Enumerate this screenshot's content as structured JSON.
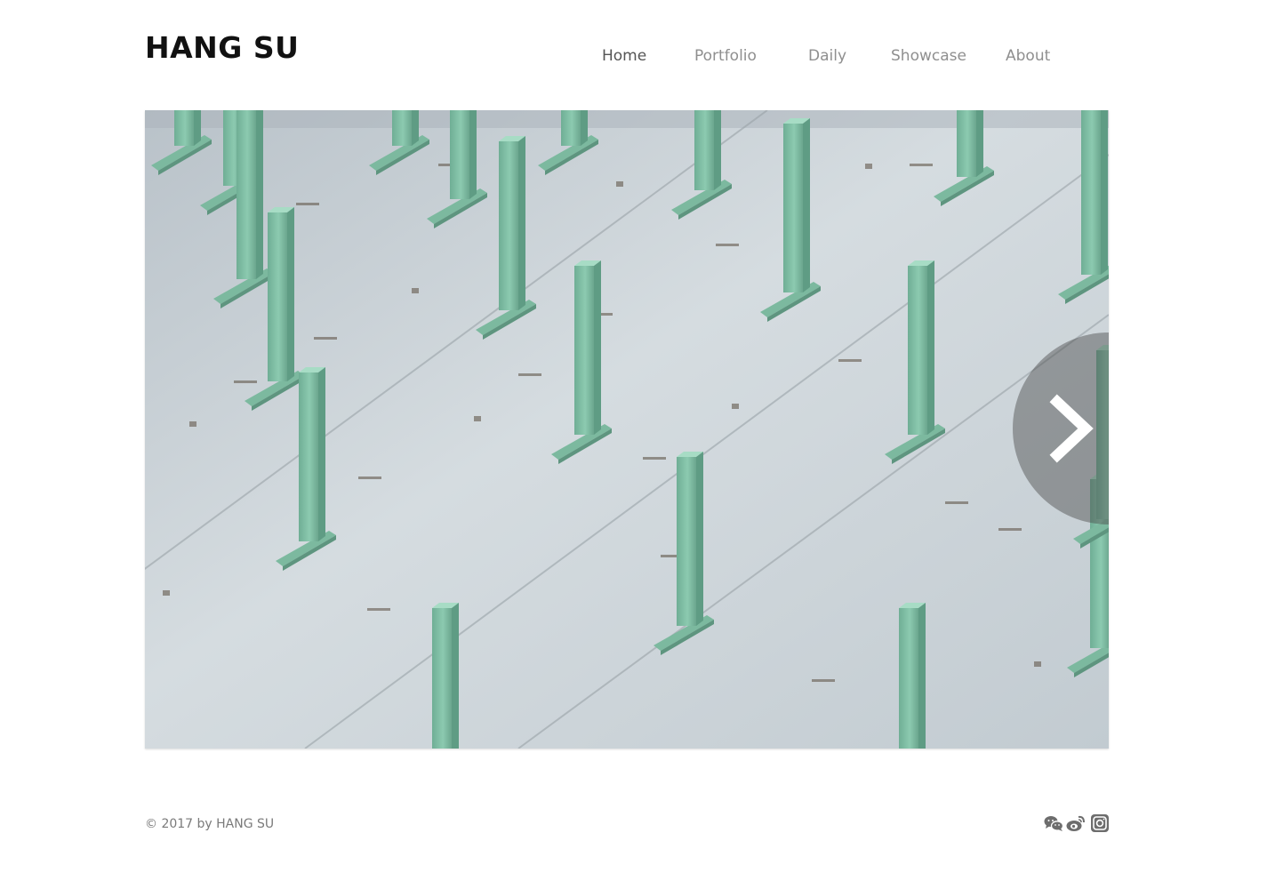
{
  "site": {
    "title": "HANG SU"
  },
  "nav": {
    "items": [
      {
        "label": "Home",
        "active": true
      },
      {
        "label": "Portfolio",
        "active": false
      },
      {
        "label": "Daily",
        "active": false
      },
      {
        "label": "Showcase",
        "active": false
      },
      {
        "label": "About",
        "active": false
      }
    ]
  },
  "slideshow": {
    "image": "photo of mint-green T-shaped posts on a concrete slab",
    "next_icon": "chevron-right-icon"
  },
  "footer": {
    "copyright": "© 2017 by HANG SU",
    "social": [
      {
        "icon": "wechat-icon"
      },
      {
        "icon": "weibo-icon"
      },
      {
        "icon": "instagram-icon"
      }
    ]
  },
  "colors": {
    "post_green": "#7fbfa5",
    "concrete": "#c9d2d8",
    "nav_active": "#555555",
    "nav_inactive": "#8f8f8f"
  }
}
